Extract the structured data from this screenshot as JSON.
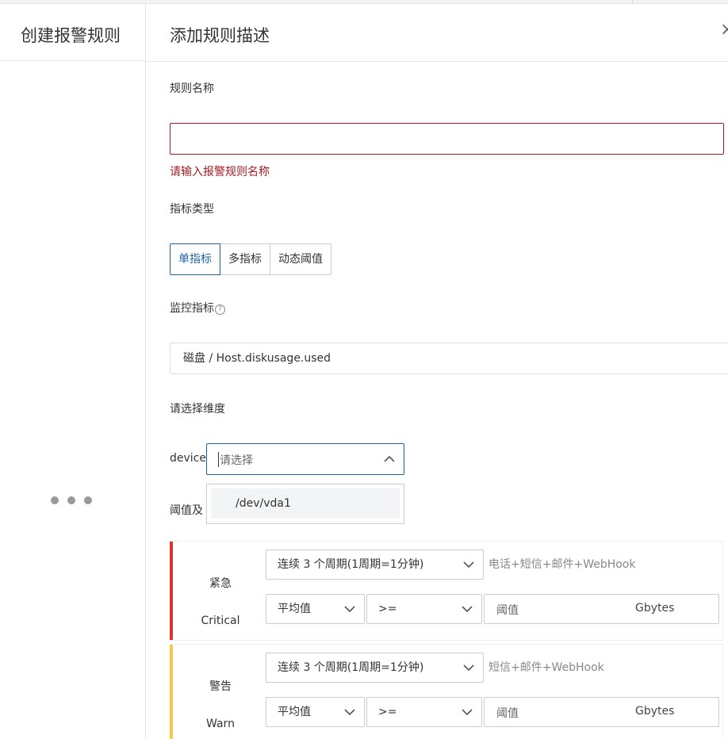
{
  "left_panel": {
    "title": "创建报警规则"
  },
  "drawer": {
    "title": "添加规则描述",
    "close_label": "×"
  },
  "rule_name": {
    "label": "规则名称",
    "value": "",
    "error": "请输入报警规则名称"
  },
  "metric_type": {
    "label": "指标类型",
    "options": [
      "单指标",
      "多指标",
      "动态阈值"
    ],
    "selected": "单指标"
  },
  "monitor_metric": {
    "label": "监控指标",
    "value": "磁盘 / Host.diskusage.used"
  },
  "dimension": {
    "label": "请选择维度",
    "device_label": "device:",
    "placeholder": "请选择",
    "options": [
      "/dev/vda1"
    ]
  },
  "threshold": {
    "label": "阈值及"
  },
  "levels": [
    {
      "name": "紧急",
      "name_en": "Critical",
      "color": "#d9342b",
      "period": "连续 3 个周期(1周期=1分钟)",
      "notify": "电话+短信+邮件+WebHook",
      "stat": "平均值",
      "operator": ">=",
      "threshold_placeholder": "阈值",
      "unit": "Gbytes"
    },
    {
      "name": "警告",
      "name_en": "Warn",
      "color": "#f7c84a",
      "period": "连续 3 个周期(1周期=1分钟)",
      "notify": "短信+邮件+WebHook",
      "stat": "平均值",
      "operator": ">=",
      "threshold_placeholder": "阈值",
      "unit": "Gbytes"
    }
  ]
}
